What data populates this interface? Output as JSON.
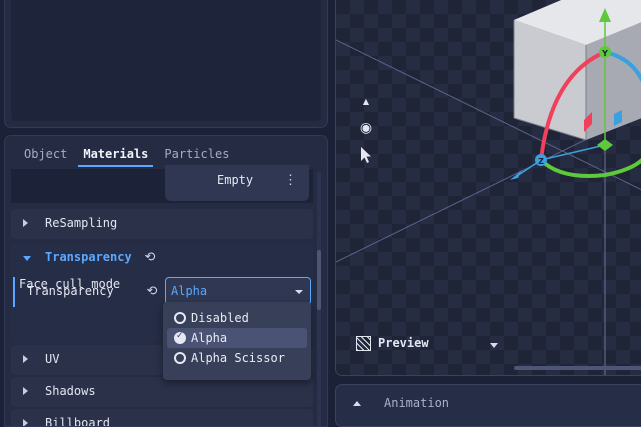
{
  "tabs": [
    {
      "label": "Object"
    },
    {
      "label": "Materials"
    },
    {
      "label": "Particles"
    }
  ],
  "active_tab": "Materials",
  "empty_button": {
    "label": "Empty",
    "menu_icon": "kebab-menu-icon"
  },
  "sections": {
    "resampling": {
      "label": "ReSampling"
    },
    "transparency": {
      "label": "Transparency"
    },
    "uv": {
      "label": "UV"
    },
    "shadows": {
      "label": "Shadows"
    },
    "billboard": {
      "label": "Billboard"
    }
  },
  "transparency": {
    "prop_label": "Transparency",
    "selected_value": "Alpha",
    "cull_label": "Face cull mode",
    "options": [
      {
        "label": "Disabled",
        "selected": false
      },
      {
        "label": "Alpha",
        "selected": true
      },
      {
        "label": "Alpha Scissor",
        "selected": false
      }
    ]
  },
  "viewport": {
    "preview_label": "Preview",
    "gizmo_y_label": "Y",
    "gizmo_z_label": "Z",
    "tools": [
      "triangle-up-icon",
      "eye-icon",
      "cursor-icon"
    ]
  },
  "animation": {
    "label": "Animation"
  },
  "colors": {
    "accent": "#5aa8ff",
    "panel": "#242b42",
    "gizmo_x": "#f0405a",
    "gizmo_y": "#5ec93a",
    "gizmo_z": "#3aa0e0"
  }
}
